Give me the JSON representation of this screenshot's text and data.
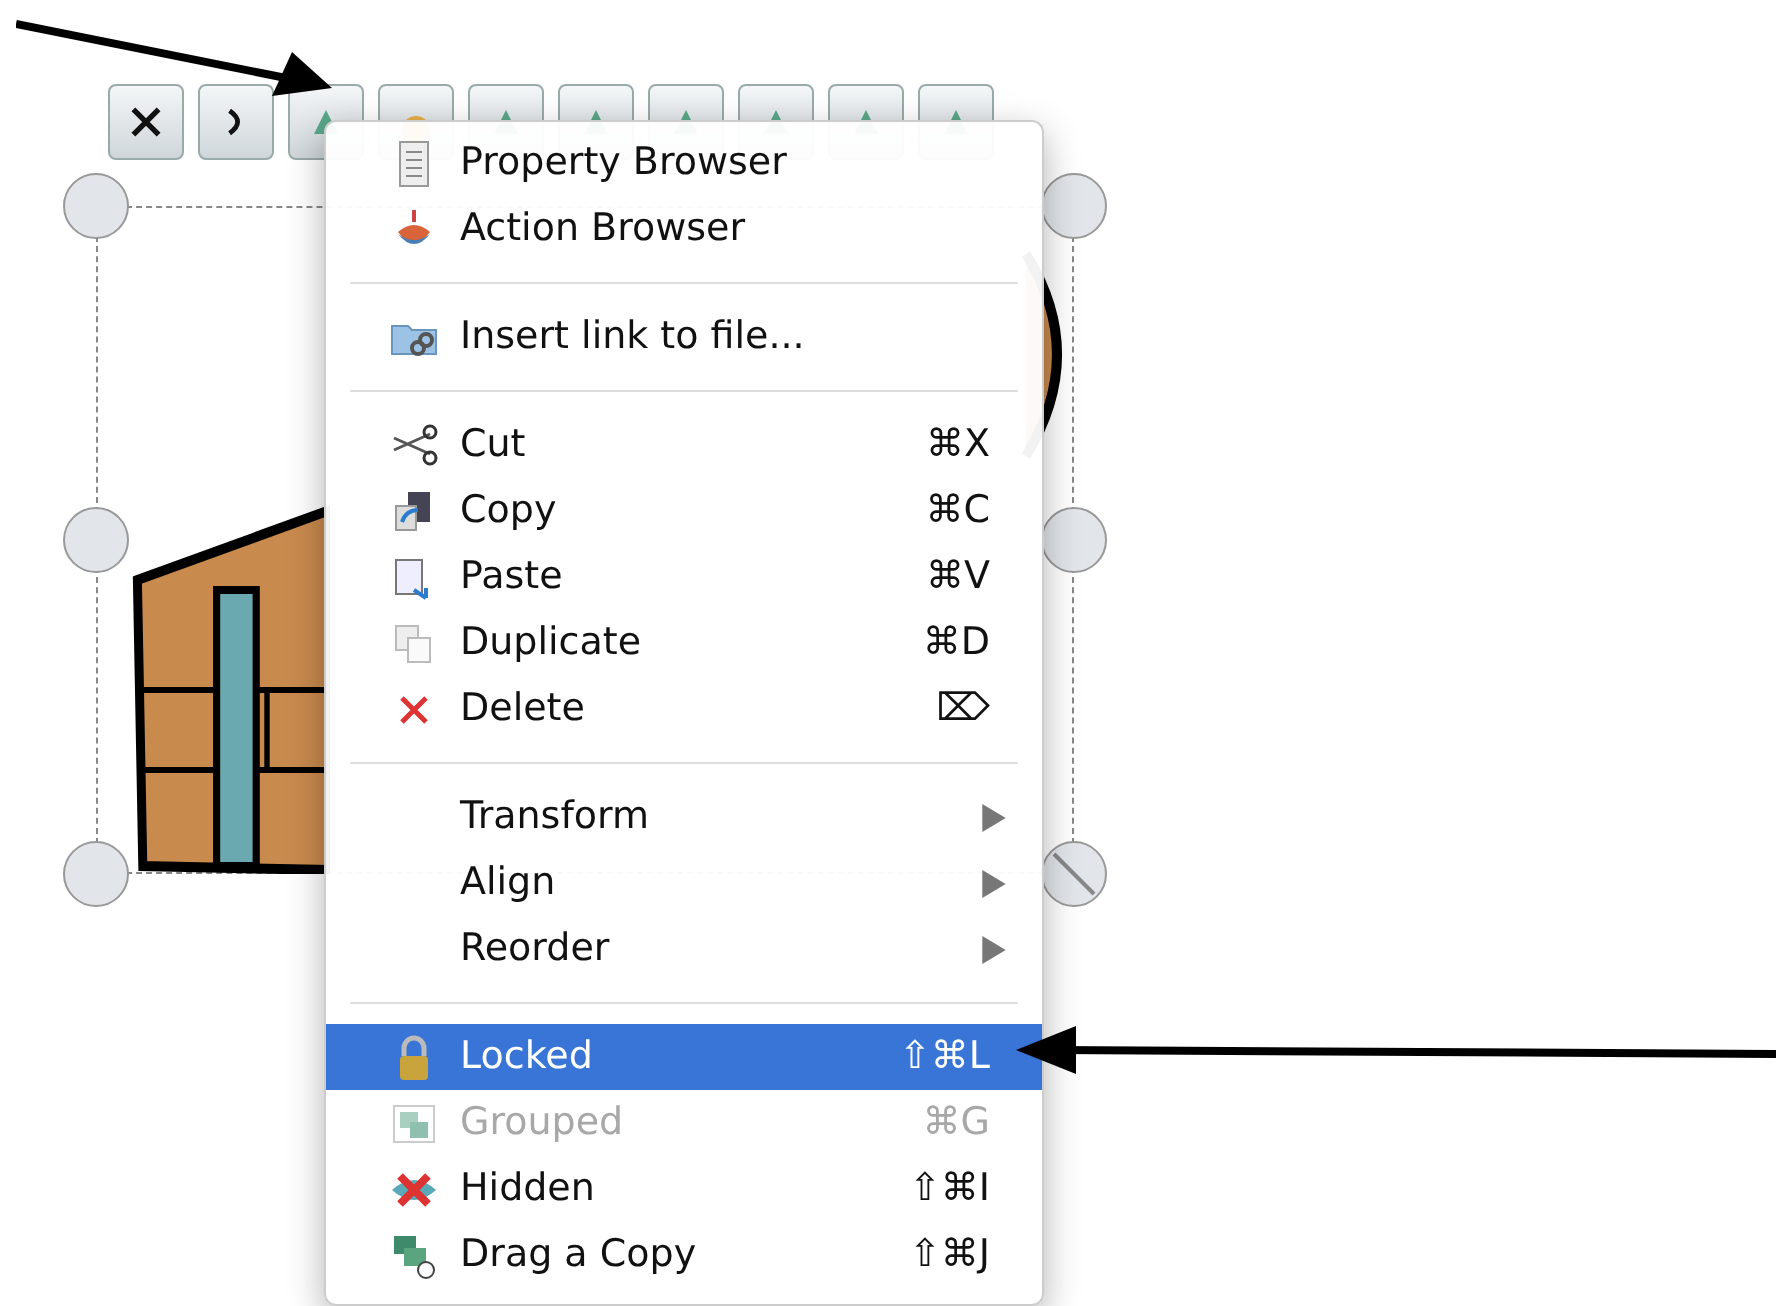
{
  "menu": {
    "sections": [
      [
        {
          "label": "Property Browser",
          "selected": false,
          "disabled": false,
          "kind": "command"
        },
        {
          "label": "Action Browser",
          "selected": false,
          "disabled": false,
          "kind": "command"
        }
      ],
      [
        {
          "label": "Insert link to file...",
          "selected": false,
          "disabled": false,
          "kind": "command"
        }
      ],
      [
        {
          "label": "Cut",
          "shortcut": "⌘X",
          "selected": false,
          "disabled": false,
          "kind": "command"
        },
        {
          "label": "Copy",
          "shortcut": "⌘C",
          "selected": false,
          "disabled": false,
          "kind": "command"
        },
        {
          "label": "Paste",
          "shortcut": "⌘V",
          "selected": false,
          "disabled": false,
          "kind": "command"
        },
        {
          "label": "Duplicate",
          "shortcut": "⌘D",
          "selected": false,
          "disabled": false,
          "kind": "command"
        },
        {
          "label": "Delete",
          "shortcut": "⌦",
          "selected": false,
          "disabled": false,
          "kind": "command"
        }
      ],
      [
        {
          "label": "Transform",
          "selected": false,
          "disabled": false,
          "kind": "submenu"
        },
        {
          "label": "Align",
          "selected": false,
          "disabled": false,
          "kind": "submenu"
        },
        {
          "label": "Reorder",
          "selected": false,
          "disabled": false,
          "kind": "submenu"
        }
      ],
      [
        {
          "label": "Locked",
          "shortcut": "⇧⌘L",
          "selected": true,
          "disabled": false,
          "kind": "command"
        },
        {
          "label": "Grouped",
          "shortcut": "⌘G",
          "selected": false,
          "disabled": true,
          "kind": "command"
        },
        {
          "label": "Hidden",
          "shortcut": "⇧⌘I",
          "selected": false,
          "disabled": false,
          "kind": "command"
        },
        {
          "label": "Drag a Copy",
          "shortcut": "⇧⌘J",
          "selected": false,
          "disabled": false,
          "kind": "command"
        }
      ]
    ]
  }
}
